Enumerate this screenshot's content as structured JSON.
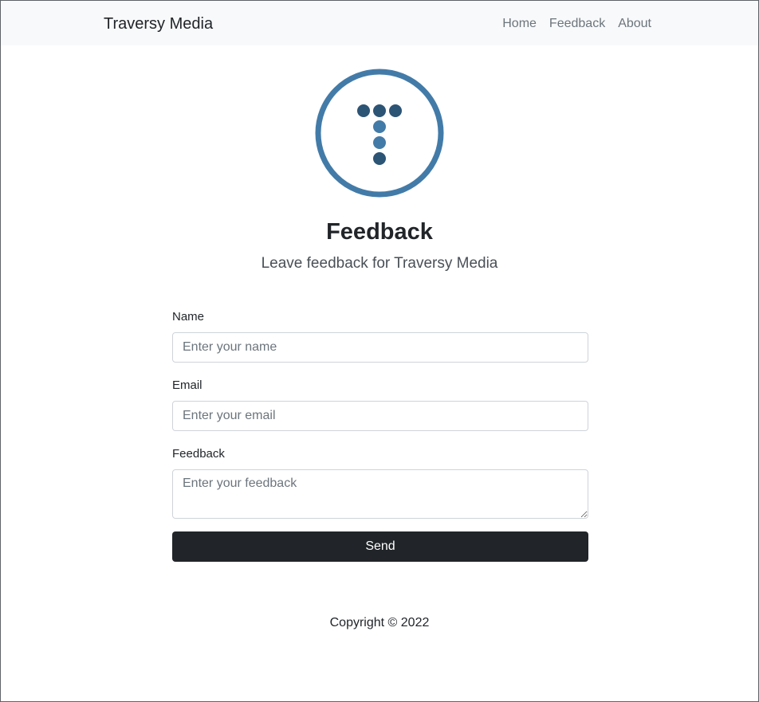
{
  "navbar": {
    "brand": "Traversy Media",
    "links": [
      "Home",
      "Feedback",
      "About"
    ]
  },
  "logo": {
    "icon": "traversy-logo",
    "ring_color": "#437ba8",
    "dot_dark_color": "#2c5475",
    "dot_light_color": "#437ba8"
  },
  "header": {
    "title": "Feedback",
    "subtitle": "Leave feedback for Traversy Media"
  },
  "form": {
    "name_label": "Name",
    "name_placeholder": "Enter your name",
    "email_label": "Email",
    "email_placeholder": "Enter your email",
    "feedback_label": "Feedback",
    "feedback_placeholder": "Enter your feedback",
    "send_label": "Send"
  },
  "footer": {
    "copyright": "Copyright © 2022"
  }
}
